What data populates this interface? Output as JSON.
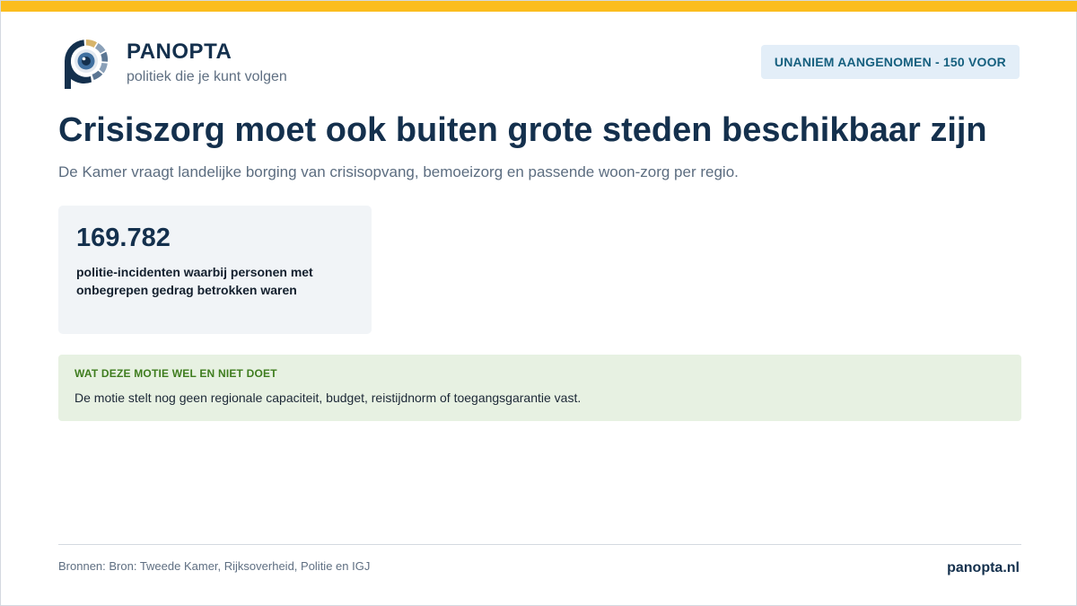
{
  "colors": {
    "accent_bar": "#fbbd1e",
    "brand_navy": "#14304d",
    "badge_bg": "#e3eef8",
    "badge_text": "#16607f",
    "info_bg": "#e7f1e2",
    "info_heading": "#3f7d1f"
  },
  "brand": {
    "name": "PANOPTA",
    "tagline": "politiek die je kunt volgen",
    "logo_icon": "panopta-eye-logo-icon"
  },
  "status_badge": "UNANIEM AANGENOMEN - 150 VOOR",
  "page": {
    "title": "Crisiszorg moet ook buiten grote steden beschikbaar zijn",
    "subtitle": "De Kamer vraagt landelijke borging van crisisopvang, bemoeizorg en passende woon-zorg per regio."
  },
  "stat": {
    "value": "169.782",
    "label": "politie-incidenten waarbij personen met onbegrepen gedrag betrokken waren"
  },
  "info": {
    "heading": "WAT DEZE MOTIE WEL EN NIET DOET",
    "text": "De motie stelt nog geen regionale capaciteit, budget, reistijdnorm of toegangsgarantie vast."
  },
  "footer": {
    "sources": "Bronnen: Bron: Tweede Kamer, Rijksoverheid, Politie en IGJ",
    "site": "panopta.nl"
  }
}
